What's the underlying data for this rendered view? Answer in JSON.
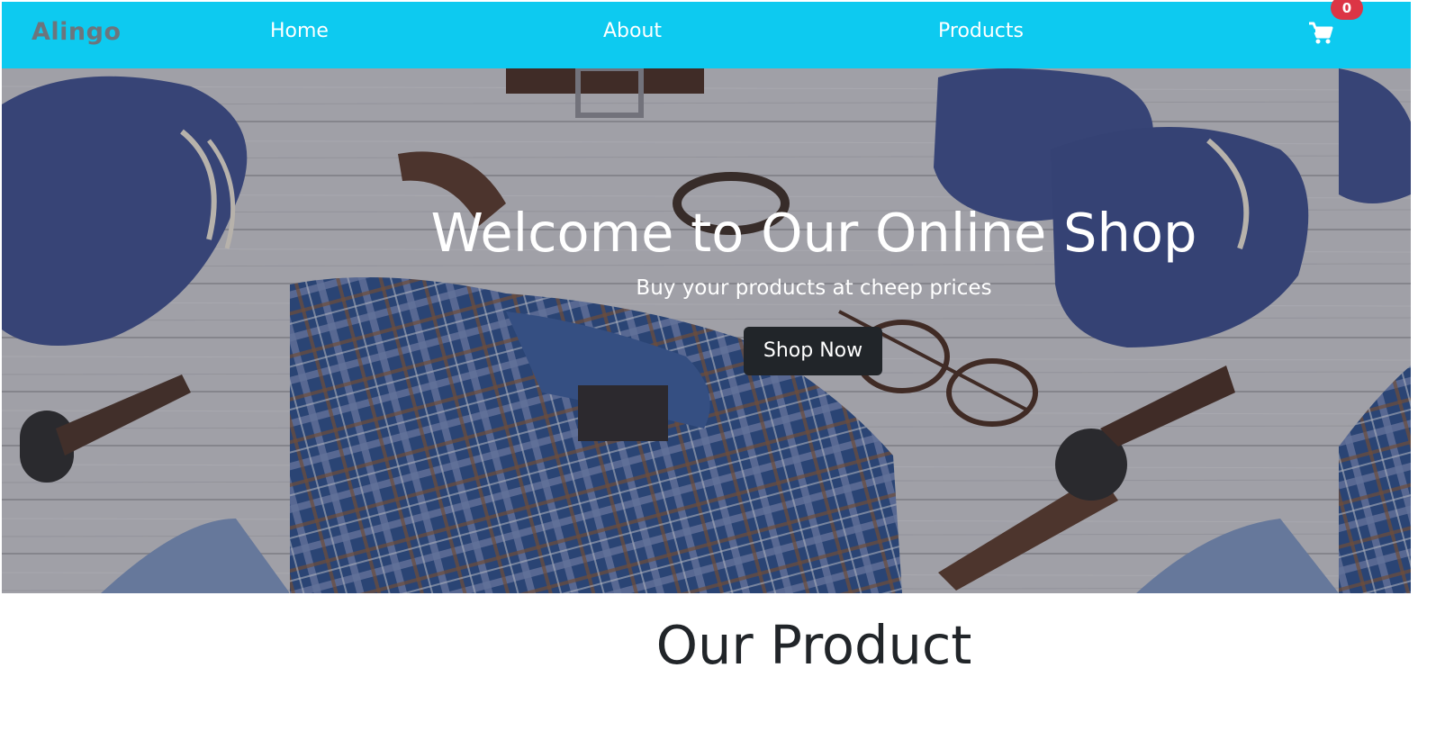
{
  "navbar": {
    "brand": "Alingo",
    "links": [
      "Home",
      "About",
      "Products"
    ],
    "cart_count": "0"
  },
  "hero": {
    "title": "Welcome to Our Online Shop",
    "subtitle": "Buy your products at cheep prices",
    "button_label": "Shop Now"
  },
  "section": {
    "title": "Our Product"
  },
  "colors": {
    "navbar": "#0dcaf0",
    "badge": "#dc3545",
    "button": "#212529"
  },
  "icons": [
    "cart-icon"
  ]
}
